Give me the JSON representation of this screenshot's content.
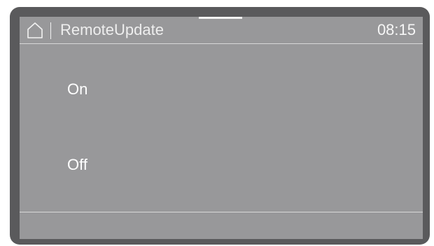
{
  "header": {
    "icon": "home-icon",
    "title": "RemoteUpdate",
    "time": "08:15"
  },
  "options": [
    {
      "label": "On"
    },
    {
      "label": "Off"
    }
  ],
  "colors": {
    "screen": "#98989a",
    "bezel": "#5a5a5c",
    "text": "#ffffff"
  }
}
